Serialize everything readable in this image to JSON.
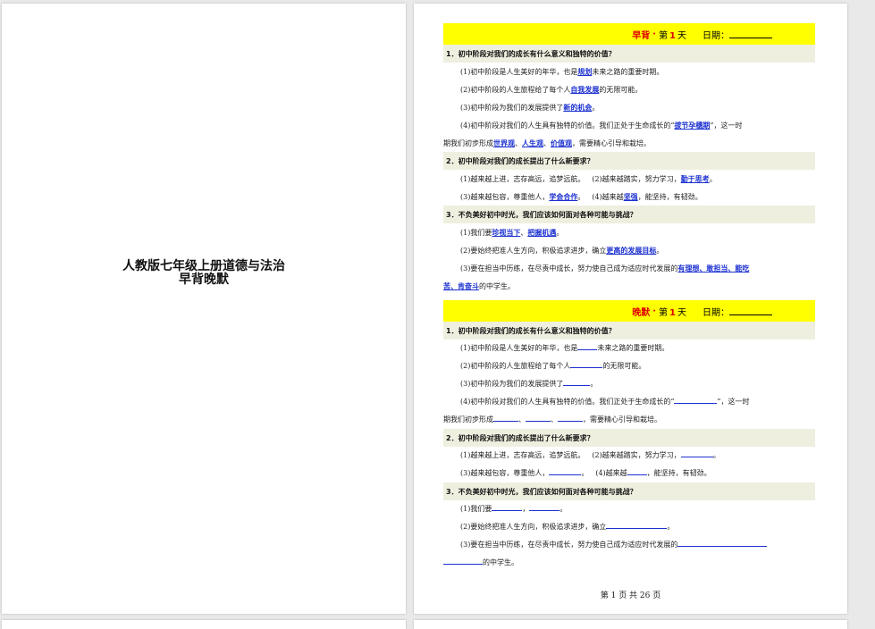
{
  "cover": {
    "title_line1": "人教版七年级上册道德与法治",
    "title_line2": "早背晚默"
  },
  "morning": {
    "kind": "早背",
    "dot": "·",
    "day_prefix": "第",
    "day_num": "1",
    "day_suffix": "天",
    "date_label": "日期：",
    "q1": "1．初中阶段对我们的成长有什么意义和独特的价值？",
    "q1a_pre": "(1)初中阶段是人生美好的年华，也是",
    "q1a_ans": "规划",
    "q1a_post": "未来之路的重要时期。",
    "q1b_pre": "(2)初中阶段的人生旅程给了每个人",
    "q1b_ans": "自我发展",
    "q1b_post": "的无限可能。",
    "q1c_pre": "(3)初中阶段为我们的发展提供了",
    "q1c_ans": "新的机会",
    "q1c_post": "。",
    "q1d_pre": "(4)初中阶段对我们的人生具有独特的价值。我们正处于生命成长的“",
    "q1d_ans": "拔节孕穗期",
    "q1d_post": "”，这一时",
    "q1d2_pre": "期我们初步形成",
    "q1d2_a1": "世界观",
    "q1d2_s1": "、",
    "q1d2_a2": "人生观",
    "q1d2_s2": "、",
    "q1d2_a3": "价值观",
    "q1d2_post": "，需要精心引导和栽培。",
    "q2": "2．初中阶段对我们的成长提出了什么新要求？",
    "q2a_pre": "(1)越来越上进，志存高远，追梦远航。",
    "q2b_pre": "(2)越来越踏实，努力学习，",
    "q2b_ans": "勤于思考",
    "q2b_post": "。",
    "q2c_pre": "(3)越来越包容，尊重他人，",
    "q2c_ans": "学会合作",
    "q2c_post": "。",
    "q2d_pre": "(4)越来越",
    "q2d_ans": "坚强",
    "q2d_post": "，能坚持，有韧劲。",
    "q3": "3．不负美好初中时光，我们应该如何面对各种可能与挑战？",
    "q3a_pre": "(1)我们要",
    "q3a_a1": "珍视当下",
    "q3a_s": "、",
    "q3a_a2": "把握机遇",
    "q3a_post": "。",
    "q3b_pre": "(2)要始终把准人生方向，积极追求进步，确立",
    "q3b_ans": "更高的发展目标",
    "q3b_post": "。",
    "q3c_pre": "(3)要在担当中历练，在尽责中成长，努力使自己成为适应时代发展的",
    "q3c_ans": "有理想、敢担当、能吃",
    "q3c2_ans": "苦、肯奋斗",
    "q3c2_post": "的中学生。"
  },
  "evening": {
    "kind": "晚默",
    "dot": "·",
    "day_prefix": "第",
    "day_num": "1",
    "day_suffix": "天",
    "date_label": "日期：",
    "q1": "1．初中阶段对我们的成长有什么意义和独特的价值？",
    "q1a_pre": "(1)初中阶段是人生美好的年华，也是",
    "q1a_post": "未来之路的重要时期。",
    "q1b_pre": "(2)初中阶段的人生旅程给了每个人",
    "q1b_post": "的无限可能。",
    "q1c_pre": "(3)初中阶段为我们的发展提供了",
    "q1c_post": "。",
    "q1d_pre": "(4)初中阶段对我们的人生具有独特的价值。我们正处于生命成长的“",
    "q1d_post": "”，这一时",
    "q1d2_pre": "期我们初步形成",
    "q1d2_s1": "、",
    "q1d2_s2": "、",
    "q1d2_post": "，需要精心引导和栽培。",
    "q2": "2．初中阶段对我们的成长提出了什么新要求？",
    "q2a_pre": "(1)越来越上进，志存高远，追梦远航。",
    "q2b_pre": "(2)越来越踏实，努力学习，",
    "q2b_post": "。",
    "q2c_pre": "(3)越来越包容，尊重他人，",
    "q2c_post": "。",
    "q2d_pre": "(4)越来越",
    "q2d_post": "，能坚持，有韧劲。",
    "q3": "3．不负美好初中时光，我们应该如何面对各种可能与挑战？",
    "q3a_pre": "(1)我们要",
    "q3a_s": "，",
    "q3a_post": "。",
    "q3b_pre": "(2)要始终把准人生方向，积极追求进步，确立",
    "q3b_post": "。",
    "q3c_pre": "(3)要在担当中历练，在尽责中成长，努力使自己成为适应时代发展的",
    "q3c2_post": "的中学生。"
  },
  "footer": {
    "text": "第 1 页 共 26 页"
  },
  "colors": {
    "banner": "#ffff00",
    "accent_red": "#e00000",
    "answer_blue": "#1b30d0",
    "question_bg": "#efefe0"
  }
}
